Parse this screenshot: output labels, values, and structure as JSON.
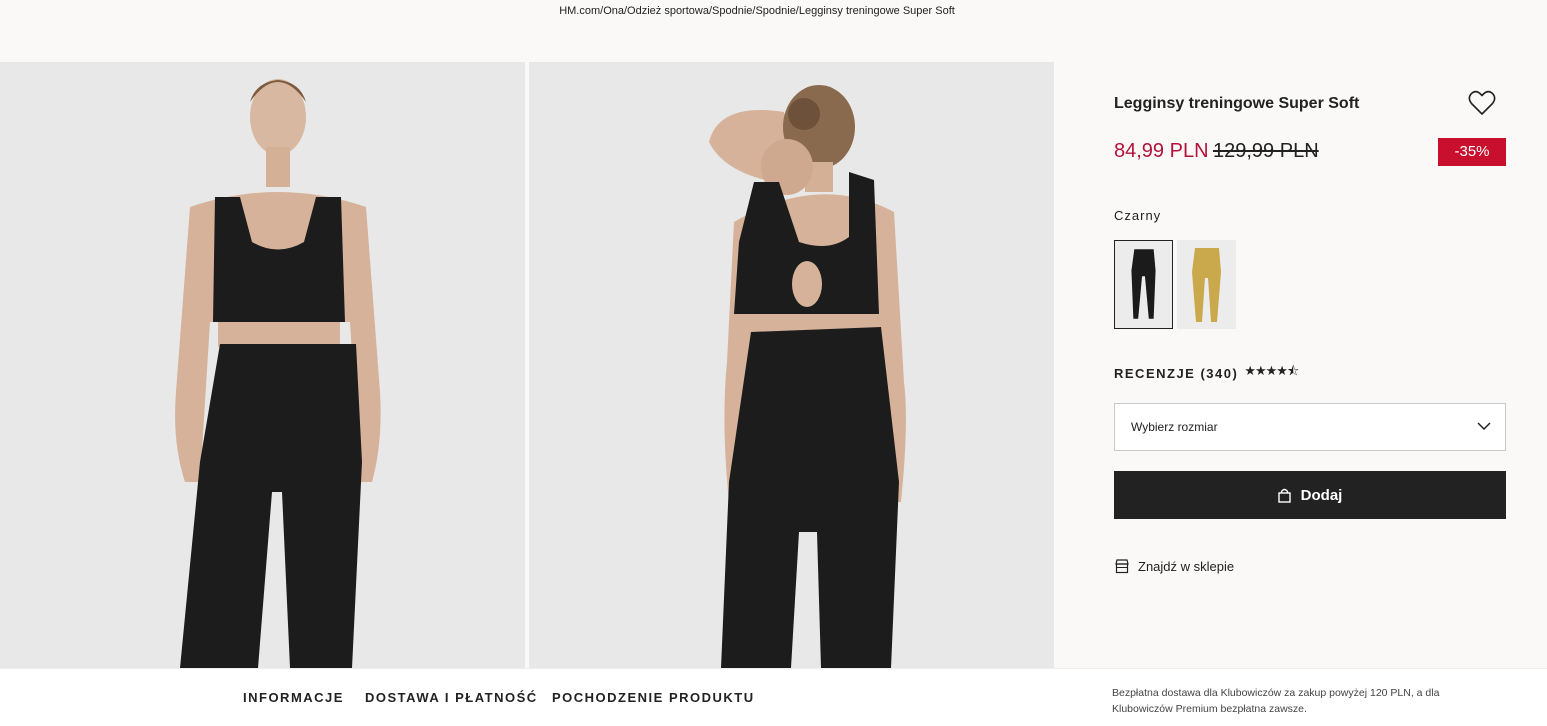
{
  "breadcrumb": "HM.com/Ona/Odzież sportowa/Spodnie/Spodnie/Legginsy treningowe Super Soft",
  "product": {
    "title": "Legginsy treningowe Super Soft",
    "price_current": "84,99 PLN",
    "price_old": "129,99 PLN",
    "discount": "-35%",
    "color_name": "Czarny",
    "colors": [
      "#1b1b1b",
      "#c9a94c"
    ],
    "reviews_label": "RECENZJE (340)",
    "rating_stars": 4.5,
    "size_placeholder": "Wybierz rozmiar",
    "add_label": "Dodaj",
    "store_label": "Znajdź w sklepie"
  },
  "bottom": {
    "tab_info": "INFORMACJE",
    "tab_delivery": "DOSTAWA I PŁATNOŚĆ",
    "tab_origin": "POCHODZENIE PRODUKTU",
    "delivery_note": "Bezpłatna dostawa dla Klubowiczów za zakup powyżej 120 PLN, a dla Klubowiczów Premium bezpłatna zawsze."
  },
  "icons": [
    "heart-icon",
    "chevron-down-icon",
    "bag-icon",
    "store-icon",
    "star-icon"
  ],
  "colors": {
    "accent_price": "#b4123a",
    "badge": "#c8102e",
    "button": "#222222"
  }
}
